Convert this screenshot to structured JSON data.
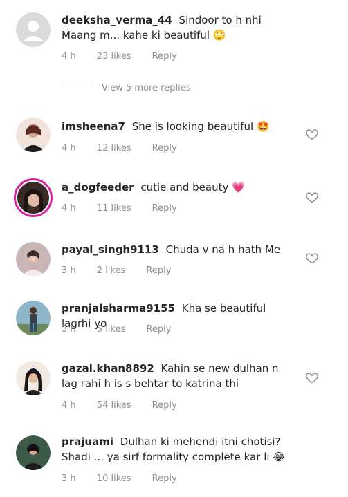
{
  "comments": [
    {
      "username": "deeksha_verma_44",
      "text": "Sindoor to h nhi Maang m... kahe ki beautiful",
      "emoji": "🙄",
      "time": "4 h",
      "likes": "23 likes",
      "reply": "Reply",
      "avatar_color": "#e6e6e6",
      "has_heart": false
    },
    {
      "username": "imsheena7",
      "text": "She is looking beautiful",
      "emoji": "🤩",
      "time": "4 h",
      "likes": "12 likes",
      "reply": "Reply",
      "avatar_color": "#c0504d",
      "has_heart": true
    },
    {
      "username": "a_dogfeeder",
      "text": "cutie and beauty",
      "emoji": "💗",
      "time": "4 h",
      "likes": "11 likes",
      "reply": "Reply",
      "avatar_color": "#3a2a24",
      "has_heart": true
    },
    {
      "username": "payal_singh9113",
      "text": "Chuda v na h hath Me",
      "emoji": "",
      "time": "3 h",
      "likes": "2 likes",
      "reply": "Reply",
      "avatar_color": "#b9a7a9",
      "has_heart": true
    },
    {
      "username": "pranjalsharma9155",
      "text": "Kha se beautiful lagrhi yo",
      "emoji": "",
      "time": "3 h",
      "likes": "5 likes",
      "reply": "Reply",
      "avatar_color": "#7da4b8",
      "has_heart": false
    },
    {
      "username": "gazal.khan8892",
      "text": "Kahin se new dulhan n lag rahi h is s behtar to katrina thi",
      "emoji": "",
      "time": "4 h",
      "likes": "54 likes",
      "reply": "Reply",
      "avatar_color": "#2b2b2b",
      "has_heart": true
    },
    {
      "username": "prajuami",
      "text": "Dulhan ki mehendi itni chotisi? Shadi ... ya sirf formality complete kar li",
      "emoji": "😂",
      "time": "3 h",
      "likes": "10 likes",
      "reply": "Reply",
      "avatar_color": "#2f4a3a",
      "has_heart": false
    }
  ],
  "view_more": "View 5 more replies",
  "icons": {
    "like": "heart-outline-icon"
  }
}
